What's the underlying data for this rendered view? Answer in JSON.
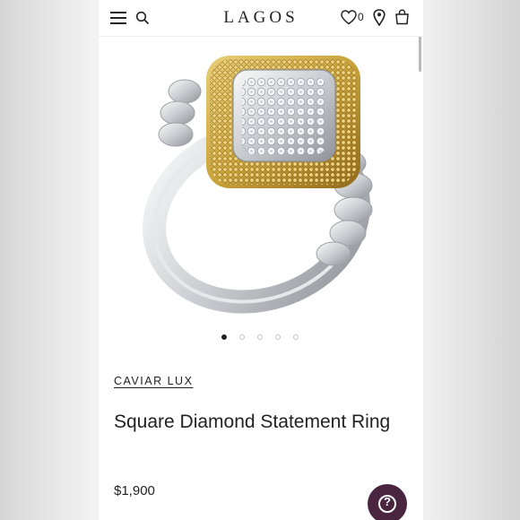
{
  "header": {
    "logo": "LAGOS",
    "wishlist_count": "0",
    "icons": [
      "menu-icon",
      "search-icon",
      "heart-icon",
      "location-pin-icon",
      "shopping-bag-icon"
    ]
  },
  "gallery": {
    "total_images": 5,
    "active_index": 0
  },
  "product": {
    "collection": "CAVIAR LUX",
    "title": "Square Diamond Statement Ring",
    "price": "$1,900"
  },
  "help": {
    "label": "?",
    "color": "#4a2540"
  },
  "colors": {
    "gold": "#c9a33b",
    "silver": "#d7d9dc",
    "text": "#222222"
  }
}
